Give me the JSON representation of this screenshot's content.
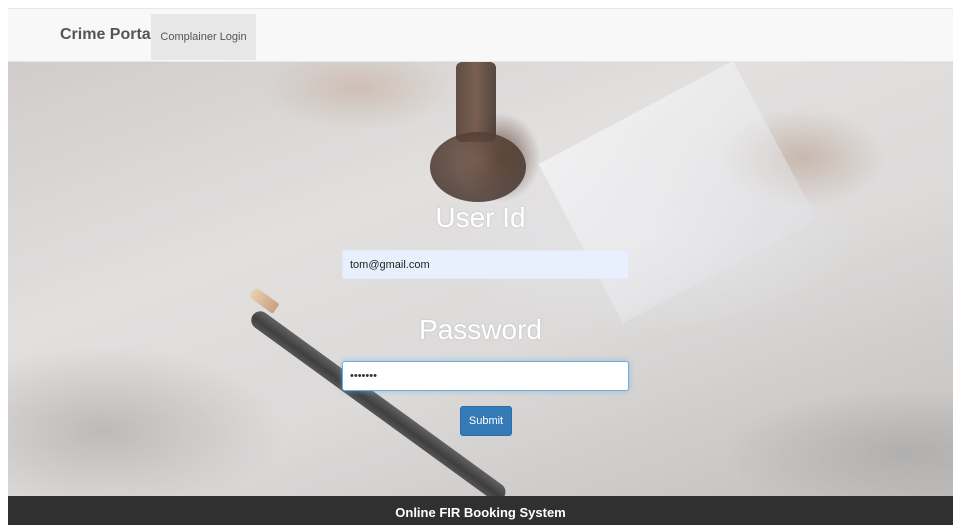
{
  "navbar": {
    "brand": "Crime Portal",
    "items": [
      {
        "label": "Complainer Login"
      }
    ]
  },
  "form": {
    "user_label": "User Id",
    "user_value": "tom@gmail.com",
    "password_label": "Password",
    "password_value": "•••••••",
    "submit_label": "Submit"
  },
  "footer": {
    "text": "Online FIR Booking System"
  },
  "colors": {
    "navbar_bg": "#f8f8f8",
    "active_nav_bg": "#e7e7e7",
    "submit_bg": "#337ab7",
    "footer_bg": "#303030",
    "autofill_bg": "#e8f0fe",
    "focus_border": "#66afe9"
  }
}
